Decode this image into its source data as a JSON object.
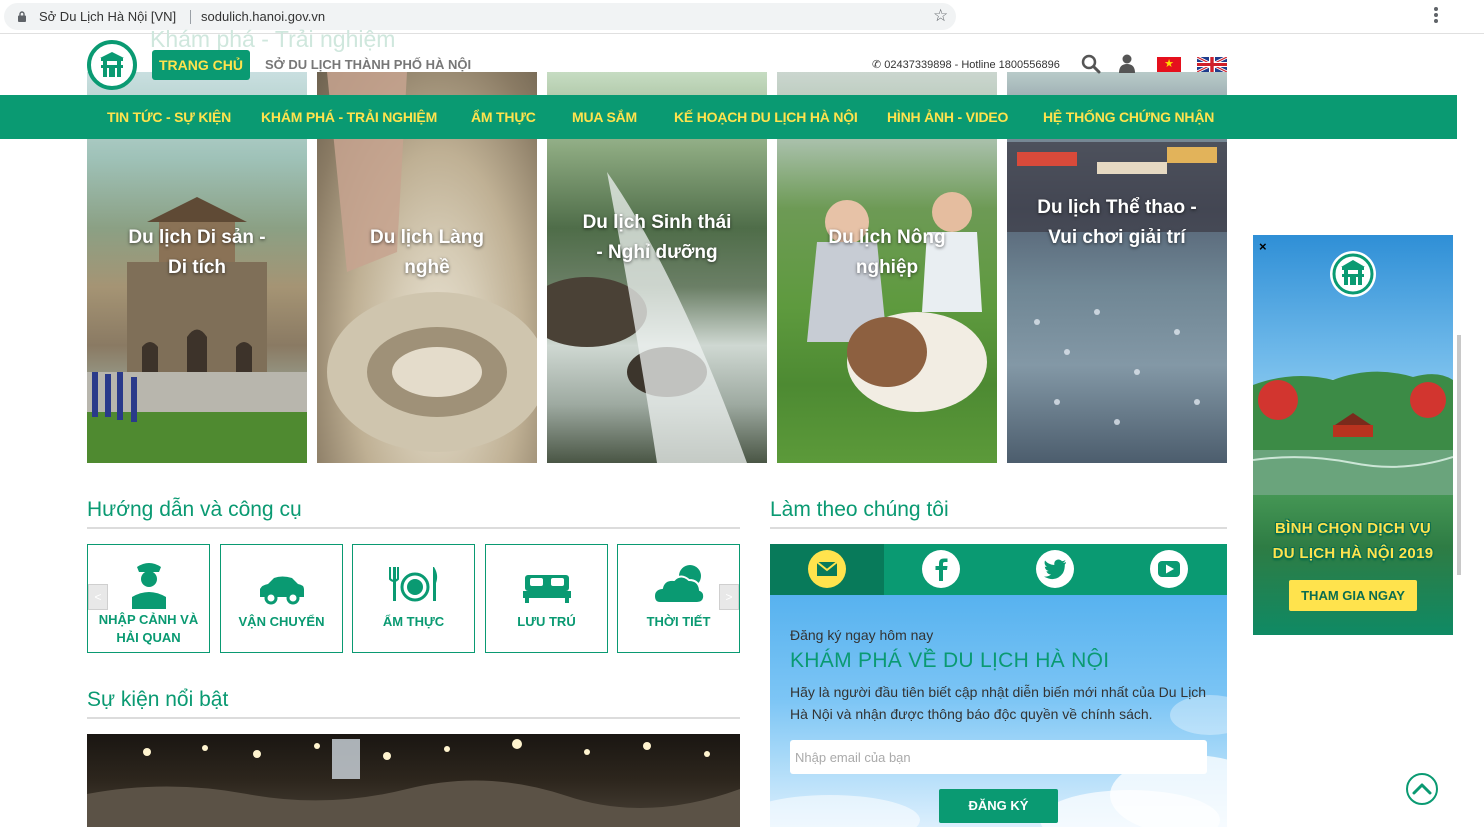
{
  "browser": {
    "tab_title": "Sở Du Lịch Hà Nội [VN]",
    "url": "sodulich.hanoi.gov.vn"
  },
  "header": {
    "ghost_heading": "Khám phá - Trải nghiệm",
    "home_label": "TRANG CHỦ",
    "site_name": "SỞ DU LỊCH THÀNH PHỐ HÀ NỘI",
    "contact": "02437339898 - Hotline 1800556896"
  },
  "nav": {
    "items": [
      {
        "label": "TIN TỨC - SỰ KIỆN"
      },
      {
        "label": "KHÁM PHÁ - TRẢI NGHIỆM"
      },
      {
        "label": "ẨM THỰC"
      },
      {
        "label": "MUA SẮM"
      },
      {
        "label": "KẾ HOẠCH DU LỊCH HÀ NỘI"
      },
      {
        "label": "HÌNH ẢNH - VIDEO"
      },
      {
        "label": "HỆ THỐNG CHỨNG NHẬN"
      }
    ]
  },
  "tiles": [
    {
      "label": "Du lịch Di sản - Di tích"
    },
    {
      "label": "Du lịch Làng nghề"
    },
    {
      "label": "Du lịch Sinh thái - Nghỉ dưỡng"
    },
    {
      "label": "Du lịch Nông nghiệp"
    },
    {
      "label": "Du lịch Thể thao - Vui chơi giải trí"
    }
  ],
  "guides": {
    "heading": "Hướng dẫn và công cụ",
    "prev": "<",
    "next": ">",
    "items": [
      {
        "label": "NHẬP CẢNH VÀ HẢI QUAN",
        "icon": "officer-icon"
      },
      {
        "label": "VẬN CHUYỂN",
        "icon": "car-icon"
      },
      {
        "label": "ẨM THỰC",
        "icon": "dining-icon"
      },
      {
        "label": "LƯU TRÚ",
        "icon": "bed-icon"
      },
      {
        "label": "THỜI TIẾT",
        "icon": "cloud-icon"
      }
    ]
  },
  "events": {
    "heading": "Sự kiện nổi bật"
  },
  "follow": {
    "heading": "Làm theo chúng tôi",
    "social": [
      "mail-icon",
      "facebook-icon",
      "twitter-icon",
      "youtube-icon"
    ],
    "subscribe_small": "Đăng ký ngay hôm nay",
    "subscribe_big": "KHÁM PHÁ VỀ DU LỊCH HÀ NỘI",
    "subscribe_desc": "Hãy là người đầu tiên biết cập nhật diễn biến mới nhất của Du Lịch Hà Nội và nhận được thông báo độc quyền về chính sách.",
    "email_placeholder": "Nhập email của bạn",
    "submit_label": "ĐĂNG KÝ"
  },
  "popup": {
    "close": "×",
    "title_line1": "BÌNH CHỌN DỊCH VỤ",
    "title_line2": "DU LỊCH HÀ NỘI 2019",
    "button_label": "THAM GIA NGAY"
  },
  "colors": {
    "brand_green": "#0a9a72",
    "accent_yellow": "#ffe34d"
  }
}
